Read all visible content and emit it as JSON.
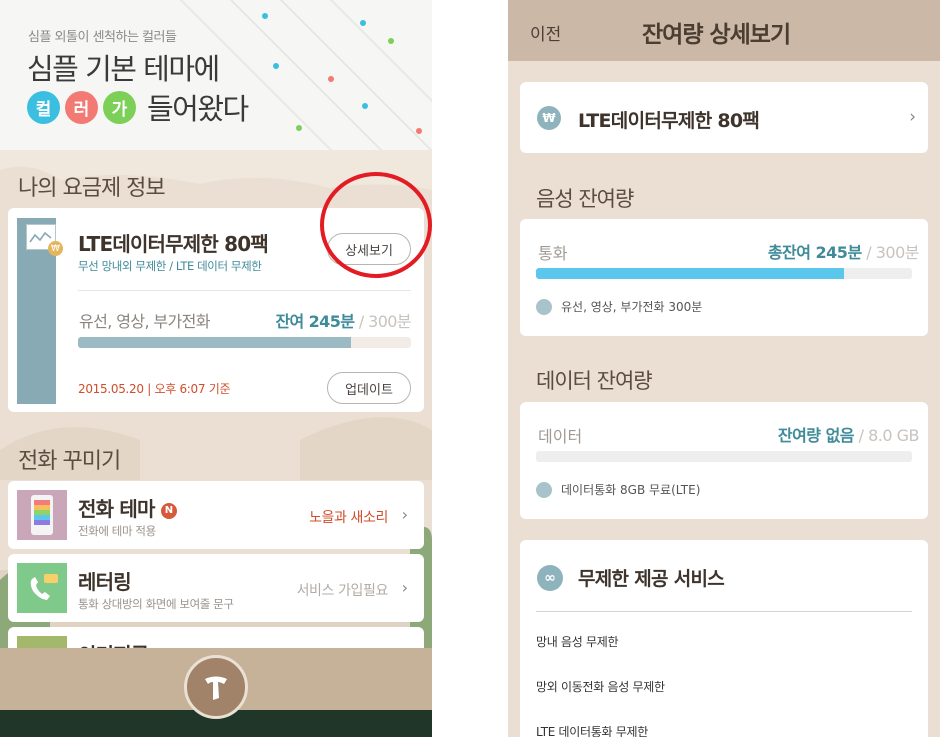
{
  "colors": {
    "accent_teal": "#3f8b9a",
    "date_red": "#d14d2b",
    "annotation_ring": "#e31b23",
    "voice_bar": "#5cc7ec",
    "header_bg": "#cbb8a6"
  },
  "left": {
    "banner": {
      "subtitle": "심플 외톨이 센척하는 컬러들",
      "title": "심플 기본 테마에",
      "color_chars": [
        {
          "char": "컬",
          "color": "#3bbfe0"
        },
        {
          "char": "러",
          "color": "#f27a72"
        },
        {
          "char": "가",
          "color": "#7ccf57"
        }
      ],
      "rest": "들어왔다"
    },
    "my_plan_section": "나의 요금제 정보",
    "plan": {
      "name": "LTE데이터무제한 80팩",
      "subtitle": "무선 망내외 무제한 / LTE 데이터 무제한",
      "detail_button": "상세보기",
      "usage_label": "유선, 영상, 부가전화",
      "remaining": "잔여 245분",
      "total": " / 300분",
      "usage_fraction": 0.82,
      "date": "2015.05.20 | 오후 6:07 기준",
      "update_button": "업데이트",
      "coin_icon": "won-coin-icon"
    },
    "decorate_section": "전화 꾸미기",
    "items": [
      {
        "title": "전화 테마",
        "badge": "N",
        "sub": "전화에 테마 적용",
        "right": "노을과 새소리",
        "right_color": "#d14d2b"
      },
      {
        "title": "레터링",
        "badge": "",
        "sub": "통화 상대방의 화면에 보여줄 문구",
        "right": "서비스 가입필요",
        "right_color": "#b1aba5"
      },
      {
        "title": "이미지콜",
        "badge": "",
        "sub": "",
        "right": "",
        "right_color": "#b1aba5"
      }
    ],
    "chevron": "›",
    "home_icon": "t-logo-icon"
  },
  "right": {
    "back": "이전",
    "title": "잔여량 상세보기",
    "plan_name": "LTE데이터무제한 80팩",
    "won_symbol": "₩",
    "voice_section": "음성 잔여량",
    "voice": {
      "label": "통화",
      "remaining": "총잔여 245분",
      "total": " / 300분",
      "fraction": 0.82,
      "note": "유선, 영상, 부가전화 300분"
    },
    "data_section": "데이터 잔여량",
    "data": {
      "label": "데이터",
      "remaining": "잔여량 없음",
      "total": " / 8.0 GB",
      "fraction": 0,
      "note": "데이터통화 8GB 무료(LTE)"
    },
    "unlimited": {
      "icon": "∞",
      "title": "무제한 제공 서비스",
      "items": [
        "망내 음성 무제한",
        "망외 이동전화 음성 무제한",
        "LTE 데이터통화 무제한"
      ]
    },
    "chevron": "›"
  }
}
